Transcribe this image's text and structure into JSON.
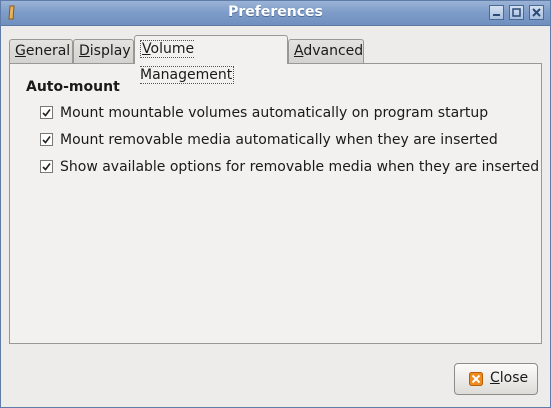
{
  "window": {
    "title": "Preferences"
  },
  "tabs": [
    {
      "label_m": "G",
      "label_rest": "eneral"
    },
    {
      "label_m": "D",
      "label_rest": "isplay"
    },
    {
      "label_m": "V",
      "label_rest": "olume Management"
    },
    {
      "label_m": "A",
      "label_rest": "dvanced"
    }
  ],
  "active_tab_index": 2,
  "automount": {
    "title": "Auto-mount",
    "options": [
      {
        "label": "Mount mountable volumes automatically on program startup",
        "checked": true
      },
      {
        "label": "Mount removable media automatically when they are inserted",
        "checked": true
      },
      {
        "label": "Show available options for removable media when they are inserted",
        "checked": true
      }
    ]
  },
  "close_button": {
    "label_m": "C",
    "label_rest": "lose"
  },
  "colors": {
    "titlebar": "#7f9dc9",
    "close_icon": "#f08a1c"
  }
}
